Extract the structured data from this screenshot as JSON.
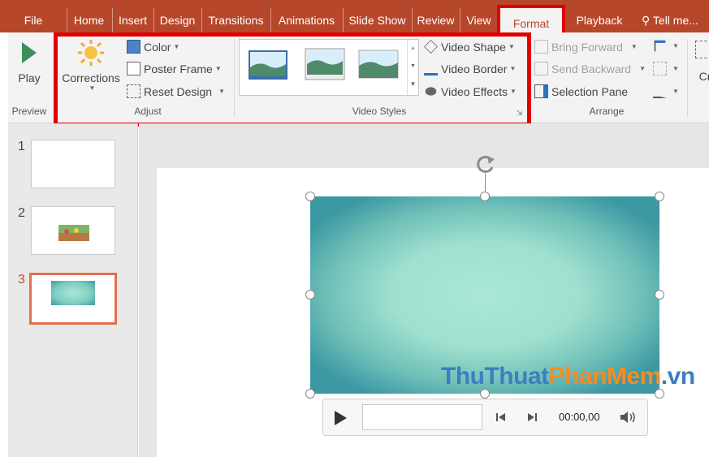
{
  "tabs": [
    {
      "label": "File"
    },
    {
      "label": "Home"
    },
    {
      "label": "Insert"
    },
    {
      "label": "Design"
    },
    {
      "label": "Transitions"
    },
    {
      "label": "Animations"
    },
    {
      "label": "Slide Show"
    },
    {
      "label": "Review"
    },
    {
      "label": "View"
    },
    {
      "label": "Format",
      "active": true
    },
    {
      "label": "Playback"
    },
    {
      "label": "Tell me..."
    }
  ],
  "preview": {
    "play_label": "Play",
    "group_label": "Preview"
  },
  "adjust": {
    "corrections_label": "Corrections",
    "color_label": "Color",
    "poster_frame_label": "Poster Frame",
    "reset_design_label": "Reset Design",
    "group_label": "Adjust"
  },
  "video_styles": {
    "video_shape_label": "Video Shape",
    "video_border_label": "Video Border",
    "video_effects_label": "Video Effects",
    "group_label": "Video Styles"
  },
  "arrange": {
    "bring_forward_label": "Bring Forward",
    "send_backward_label": "Send Backward",
    "selection_pane_label": "Selection Pane",
    "group_label": "Arrange"
  },
  "crop": {
    "label": "Cr"
  },
  "slides": [
    {
      "number": "1"
    },
    {
      "number": "2"
    },
    {
      "number": "3",
      "selected": true
    }
  ],
  "player": {
    "time": "00:00,00"
  },
  "watermark": {
    "part1": "ThuThuat",
    "part2": "PhanMem",
    "part3": ".vn"
  },
  "colors": {
    "accent": "#b7472a",
    "highlight": "#e00000",
    "watermark_blue": "#3a7fc2",
    "watermark_orange": "#f28c28"
  }
}
